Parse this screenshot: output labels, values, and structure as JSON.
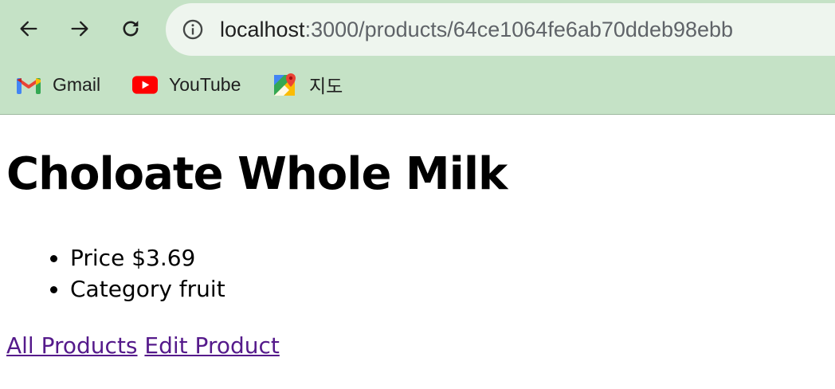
{
  "browser": {
    "url_host": "localhost",
    "url_rest": ":3000/products/64ce1064fe6ab70ddeb98ebb",
    "bookmarks": [
      {
        "label": "Gmail",
        "icon": "gmail-icon"
      },
      {
        "label": "YouTube",
        "icon": "youtube-icon"
      },
      {
        "label": "지도",
        "icon": "maps-icon"
      }
    ]
  },
  "product": {
    "name": "Choloate Whole Milk",
    "price_text": "Price $3.69",
    "category_text": "Category fruit"
  },
  "links": {
    "all_products": "All Products",
    "edit_product": "Edit Product"
  },
  "colors": {
    "chrome_background": "#c5e2c6",
    "omnibox_background": "#eef5ee",
    "visited_link": "#551a8b"
  }
}
